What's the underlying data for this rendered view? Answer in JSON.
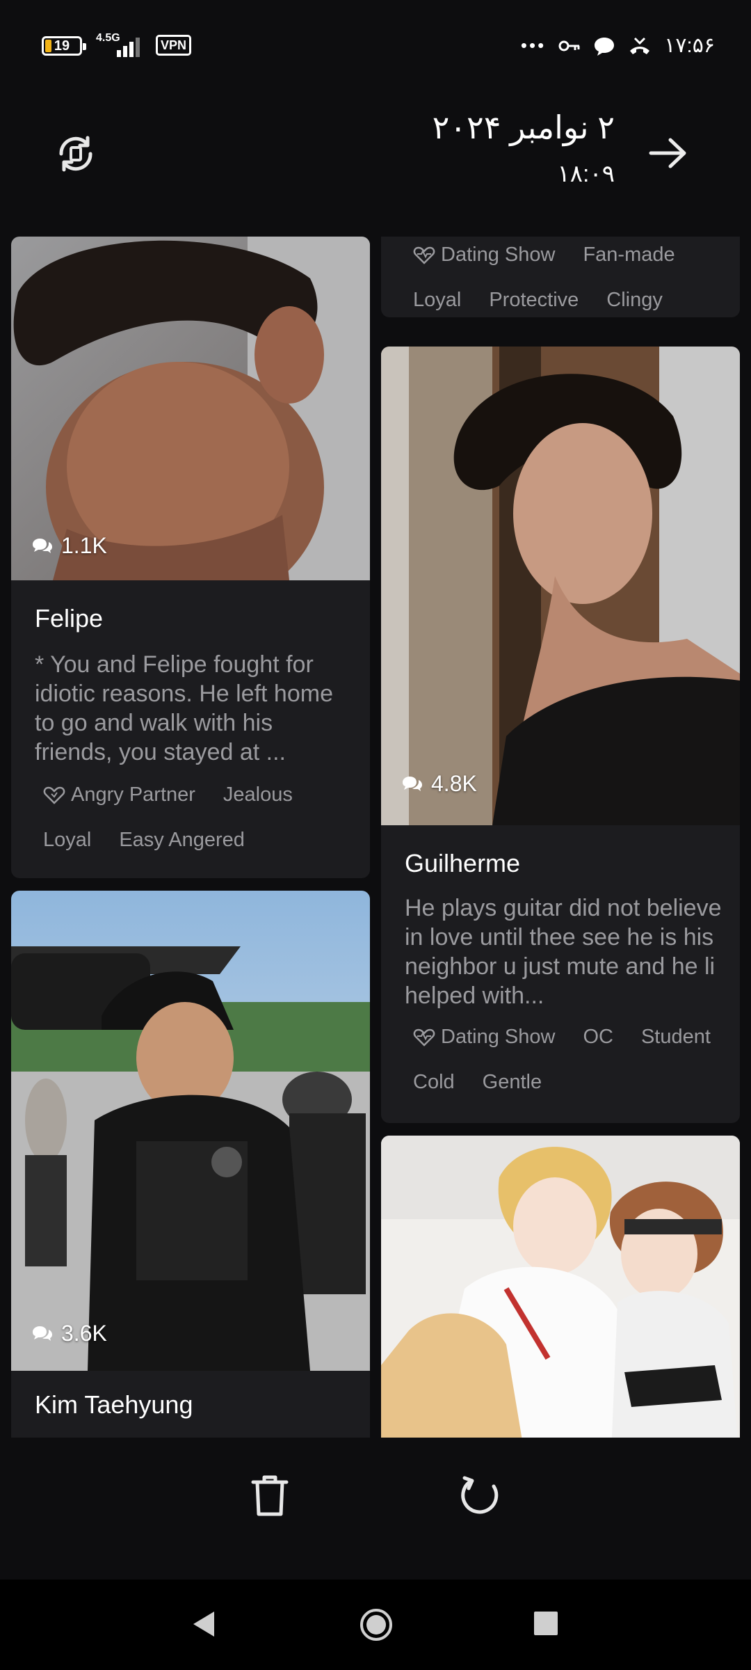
{
  "status_bar": {
    "battery": "19",
    "battery_level": 0.19,
    "network": "4.5G",
    "vpn": "VPN",
    "time": "۱۷:۵۶"
  },
  "header": {
    "date": "۲ نوامبر ۲۰۲۴",
    "time": "۱۸:۰۹"
  },
  "cards": [
    {
      "name": "Felipe",
      "chat_count": "1.1K",
      "description": "* You and Felipe fought for idiotic reasons. He left home to go and walk with his friends, you stayed at ...",
      "tags": [
        "Angry Partner",
        "Jealous",
        "Loyal",
        "Easy Angered"
      ]
    },
    {
      "name": "Kim Taehyung",
      "chat_count": "3.6K"
    },
    {
      "tags": [
        "Dating Show",
        "Fan-made",
        "Loyal",
        "Protective",
        "Clingy"
      ]
    },
    {
      "name": "Guilherme",
      "chat_count": "4.8K",
      "description": "He plays guitar did not believe in love until thee see he is his neighbor u just mute and he li helped with...",
      "tags": [
        "Dating Show",
        "OC",
        "Student",
        "Cold",
        "Gentle"
      ]
    }
  ],
  "colors": {
    "background": "#0d0d0f",
    "card": "#1c1c1f",
    "muted_text": "#9b9b9f",
    "battery": "#f3b417"
  },
  "icons": [
    "sync-icon",
    "arrow-right-icon",
    "chat-bubble-icon",
    "heart-tag-icon",
    "trash-icon",
    "reload-icon",
    "nav-back-icon",
    "nav-home-icon",
    "nav-recent-icon"
  ]
}
